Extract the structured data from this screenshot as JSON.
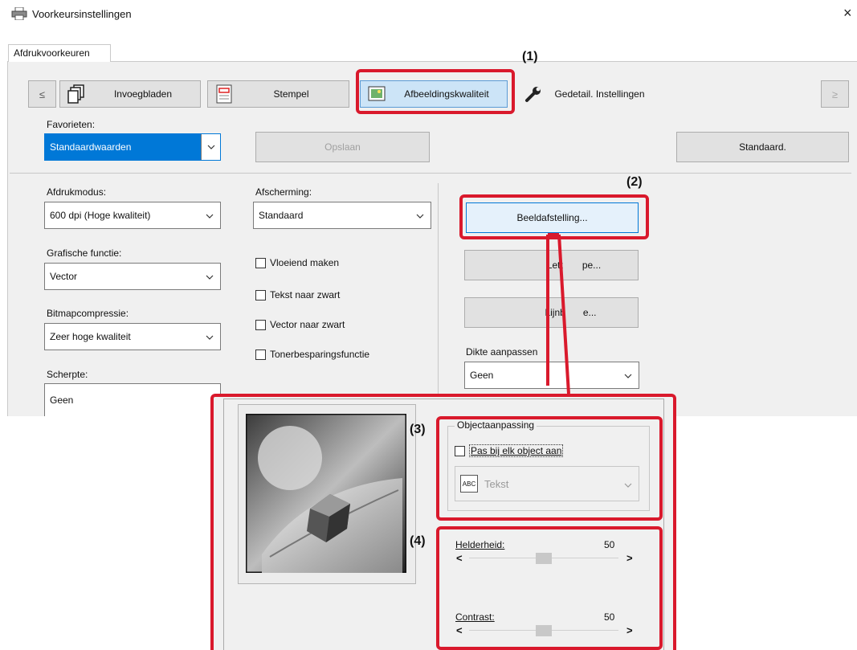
{
  "window": {
    "title": "Voorkeursinstellingen",
    "close": "×",
    "tab": "Afdrukvoorkeuren"
  },
  "toolbar": {
    "prev": "≤",
    "next": "≥",
    "items": [
      {
        "label": "Invoegbladen",
        "icon": "pages-icon"
      },
      {
        "label": "Stempel",
        "icon": "stamp-icon"
      },
      {
        "label": "Afbeeldingskwaliteit",
        "icon": "image-quality-icon"
      },
      {
        "label": "Gedetail. Instellingen",
        "icon": "wrench-icon"
      }
    ]
  },
  "callouts": {
    "c1": "(1)",
    "c2": "(2)",
    "c3": "(3)",
    "c4": "(4)"
  },
  "favorites": {
    "label": "Favorieten:",
    "value": "Standaardwaarden",
    "save": "Opslaan",
    "default": "Standaard."
  },
  "left": {
    "print_mode_label": "Afdrukmodus:",
    "print_mode_value": "600 dpi (Hoge kwaliteit)",
    "graphics_label": "Grafische functie:",
    "graphics_value": "Vector",
    "bitmap_label": "Bitmapcompressie:",
    "bitmap_value": "Zeer hoge kwaliteit",
    "sharpness_label": "Scherpte:",
    "sharpness_value": "Geen"
  },
  "middle": {
    "screening_label": "Afscherming:",
    "screening_value": "Standaard",
    "checks": [
      "Vloeiend maken",
      "Tekst naar zwart",
      "Vector naar zwart",
      "Tonerbesparingsfunctie"
    ]
  },
  "right": {
    "image_adjust": "Beeldafstelling...",
    "font_btn_a": "Lett",
    "font_btn_b": "pe...",
    "line_btn_a": "Lijnb",
    "line_btn_b": "e...",
    "thickness_label": "Dikte aanpassen",
    "thickness_value": "Geen"
  },
  "popup": {
    "object_group": "Objectaanpassing",
    "per_object": "Pas bij elk object aan",
    "object_value": "Tekst",
    "object_icon_text": "ABC",
    "brightness_label": "Helderheid:",
    "brightness_value": "50",
    "contrast_label": "Contrast:",
    "contrast_value": "50",
    "left_arrow": "<",
    "right_arrow": ">"
  },
  "sliders": {
    "brightness": 50,
    "contrast": 50
  },
  "colors": {
    "highlight_red": "#d9192c",
    "selection_blue": "#0078d7"
  }
}
